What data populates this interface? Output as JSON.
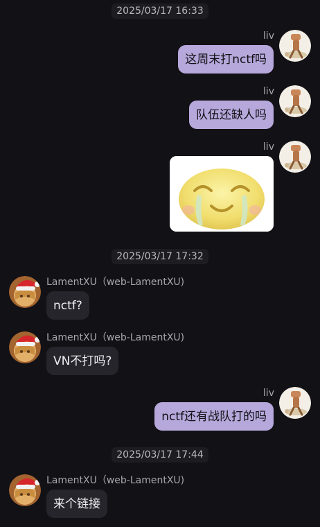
{
  "chat": {
    "timestamps": [
      "2025/03/17 16:33",
      "2025/03/17 17:32",
      "2025/03/17 17:44"
    ],
    "self": {
      "name": "liv"
    },
    "other": {
      "name": "LamentXU（web-LamentXU)"
    },
    "messages": [
      {
        "sender": "liv",
        "text": "这周末打nctf吗"
      },
      {
        "sender": "liv",
        "text": "队伍还缺人吗"
      },
      {
        "sender": "liv",
        "sticker": "crying-laughing-emoji"
      },
      {
        "sender": "LamentXU（web-LamentXU)",
        "text": "nctf?"
      },
      {
        "sender": "LamentXU（web-LamentXU)",
        "text": "VN不打吗?"
      },
      {
        "sender": "liv",
        "text": "nctf还有战队打的吗"
      },
      {
        "sender": "LamentXU（web-LamentXU)",
        "text": "来个链接"
      }
    ]
  },
  "icons": {
    "self_avatar": "walking-figure-avatar-icon",
    "other_avatar": "santa-hat-anime-avatar-icon",
    "sticker": "crying-laughing-emoji"
  },
  "colors": {
    "background": "#121116",
    "self_bubble": "#b6a8db",
    "other_bubble": "#26252b",
    "timestamp_bg": "#1d1c21"
  }
}
